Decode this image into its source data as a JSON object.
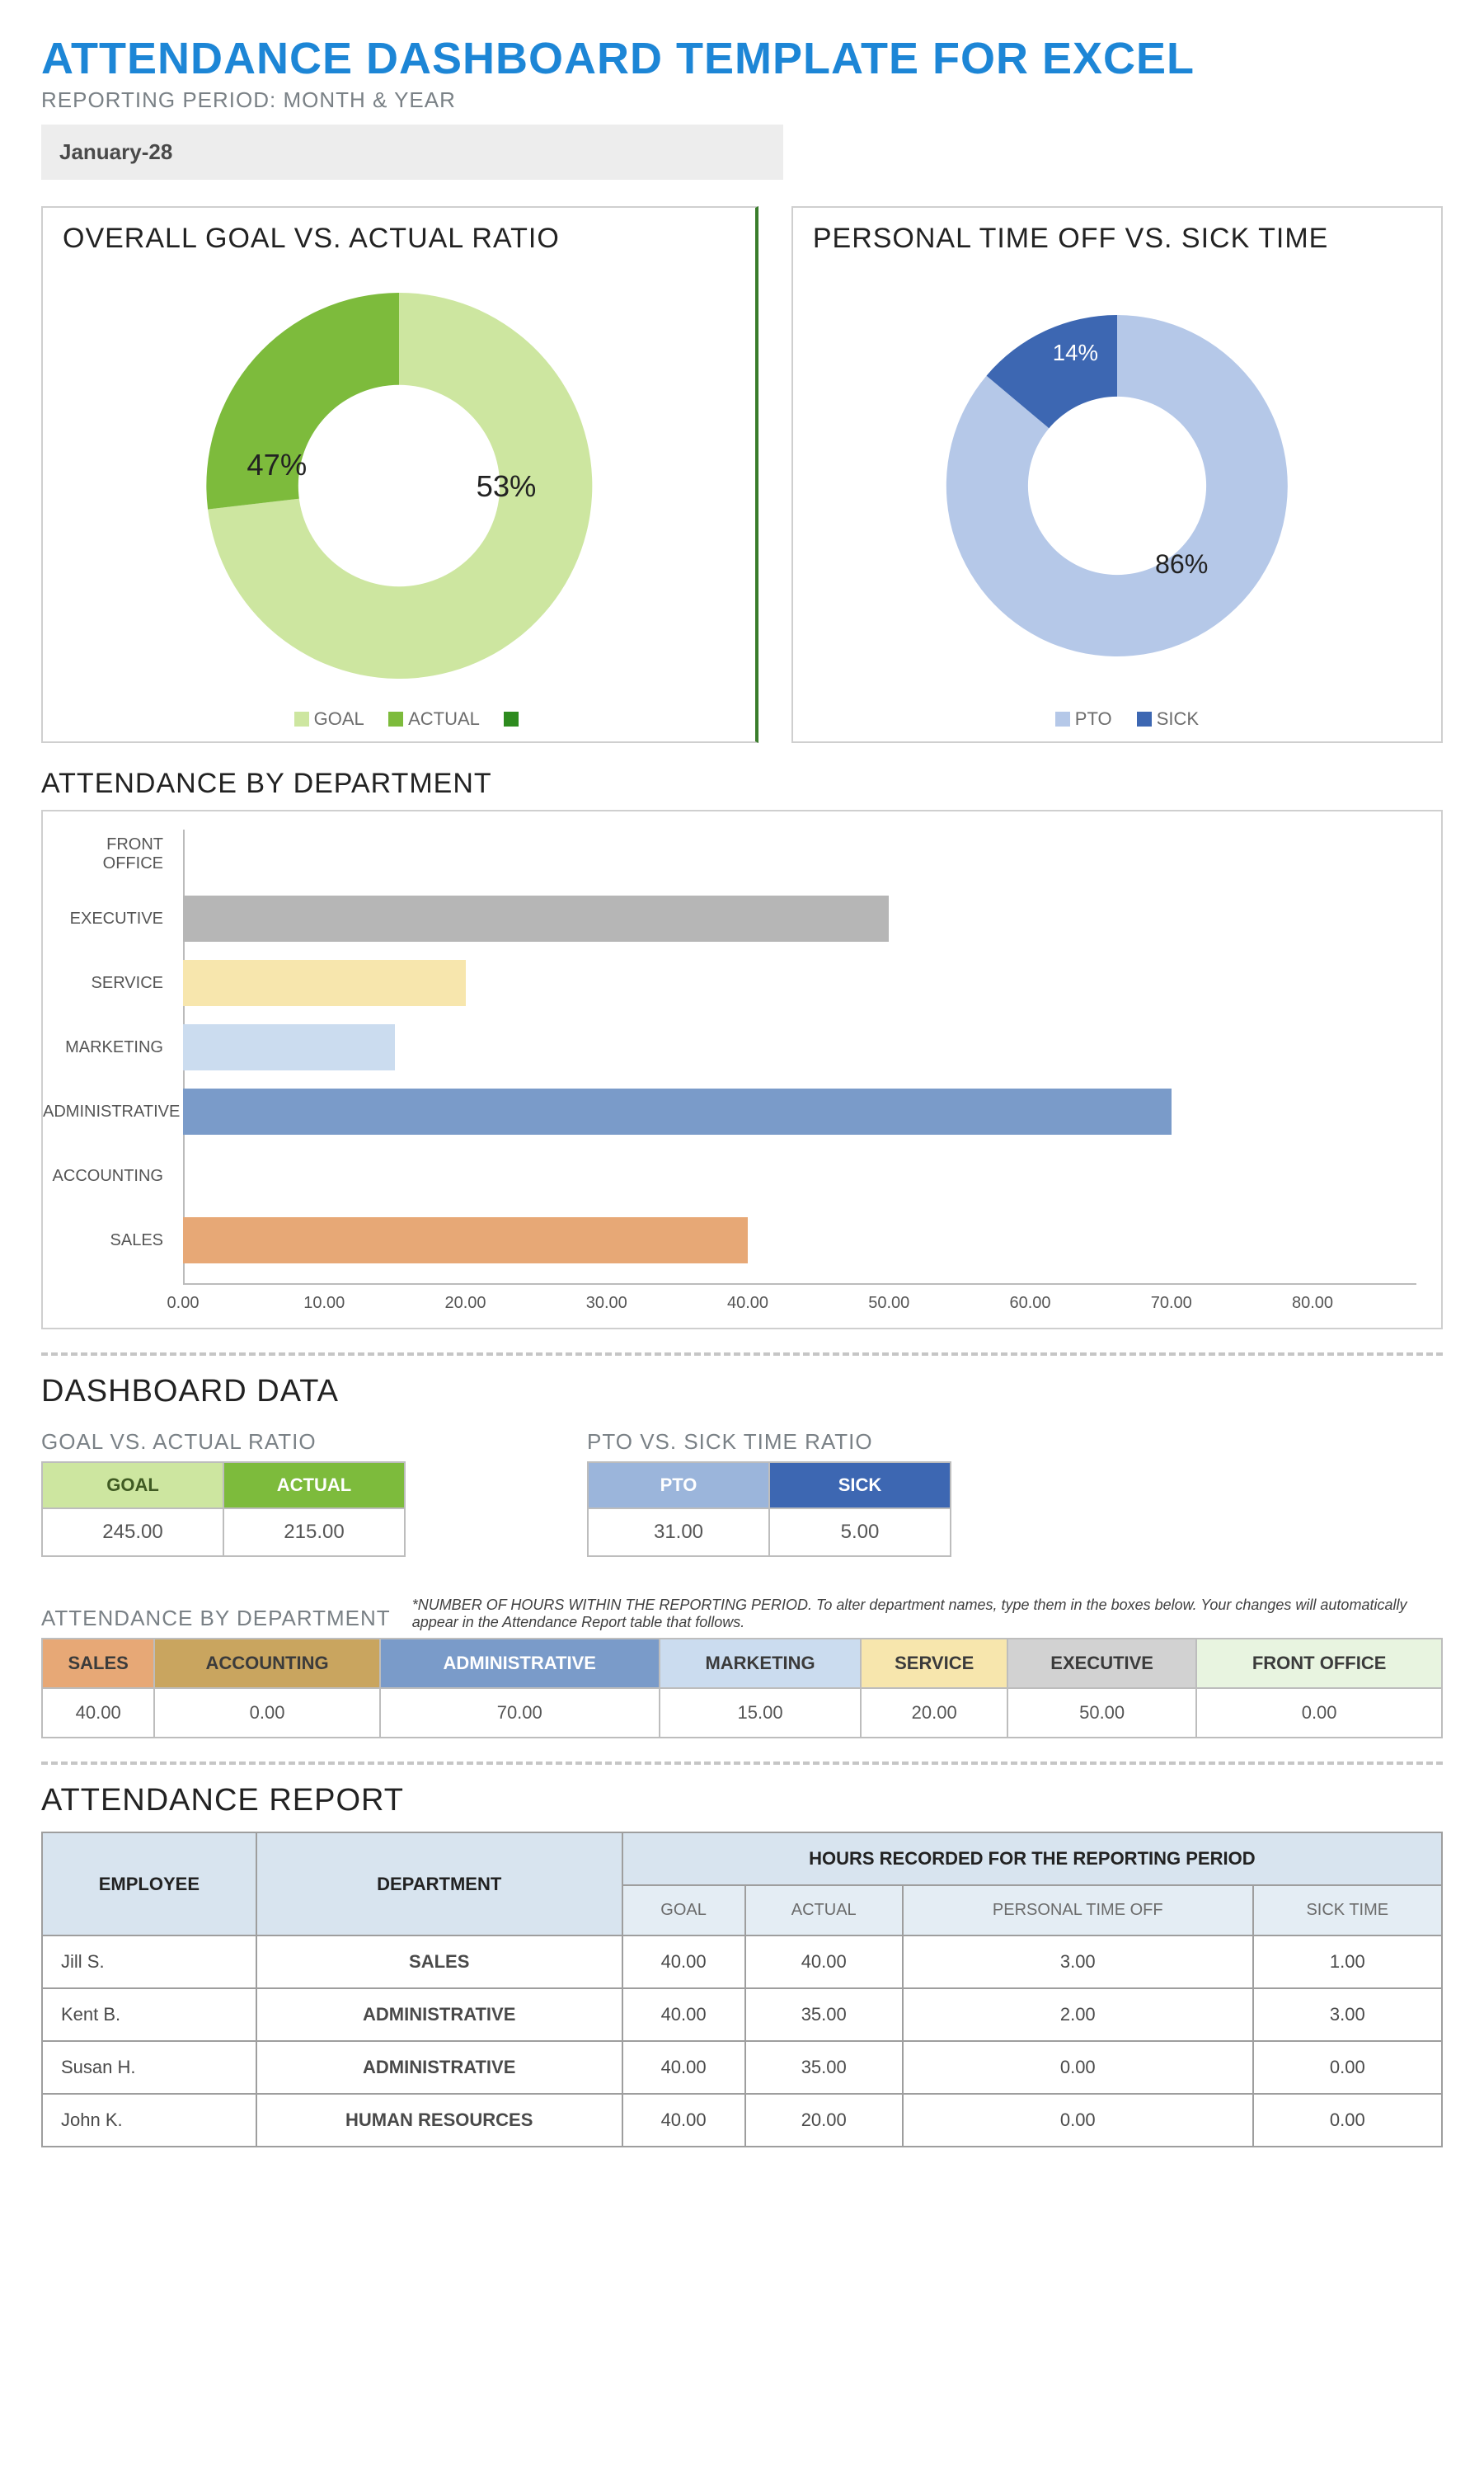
{
  "title": "ATTENDANCE DASHBOARD TEMPLATE FOR EXCEL",
  "subtitle": "REPORTING PERIOD: MONTH & YEAR",
  "period_value": "January-28",
  "panels": {
    "goal_vs_actual": {
      "title": "OVERALL GOAL VS. ACTUAL RATIO",
      "legend": {
        "a": "GOAL",
        "b": "ACTUAL",
        "c": ""
      },
      "label_a": "53%",
      "label_b": "47%"
    },
    "pto_vs_sick": {
      "title": "PERSONAL TIME OFF VS. SICK TIME",
      "legend": {
        "a": "PTO",
        "b": "SICK"
      },
      "label_a": "86%",
      "label_b": "14%"
    }
  },
  "attendance_by_dept_title": "ATTENDANCE BY DEPARTMENT",
  "dashboard_data": {
    "title": "DASHBOARD DATA",
    "goal_vs_actual": {
      "title": "GOAL VS. ACTUAL RATIO",
      "h1": "GOAL",
      "h2": "ACTUAL",
      "v1": "245.00",
      "v2": "215.00"
    },
    "pto_vs_sick": {
      "title": "PTO VS. SICK TIME RATIO",
      "h1": "PTO",
      "h2": "SICK",
      "v1": "31.00",
      "v2": "5.00"
    },
    "by_dept": {
      "title": "ATTENDANCE BY DEPARTMENT",
      "note": "*NUMBER OF HOURS WITHIN THE REPORTING PERIOD. To alter department names, type them in the boxes below. Your changes will automatically appear in the Attendance Report table that follows.",
      "headers": [
        "SALES",
        "ACCOUNTING",
        "ADMINISTRATIVE",
        "MARKETING",
        "SERVICE",
        "EXECUTIVE",
        "FRONT OFFICE"
      ],
      "values": [
        "40.00",
        "0.00",
        "70.00",
        "15.00",
        "20.00",
        "50.00",
        "0.00"
      ]
    }
  },
  "report": {
    "title": "ATTENDANCE REPORT",
    "h_employee": "EMPLOYEE",
    "h_department": "DEPARTMENT",
    "h_hours": "HOURS RECORDED FOR THE REPORTING PERIOD",
    "sub": [
      "GOAL",
      "ACTUAL",
      "PERSONAL TIME OFF",
      "SICK TIME"
    ],
    "rows": [
      {
        "emp": "Jill S.",
        "dept": "SALES",
        "c": [
          "40.00",
          "40.00",
          "3.00",
          "1.00"
        ]
      },
      {
        "emp": "Kent B.",
        "dept": "ADMINISTRATIVE",
        "c": [
          "40.00",
          "35.00",
          "2.00",
          "3.00"
        ]
      },
      {
        "emp": "Susan H.",
        "dept": "ADMINISTRATIVE",
        "c": [
          "40.00",
          "35.00",
          "0.00",
          "0.00"
        ]
      },
      {
        "emp": "John K.",
        "dept": "HUMAN RESOURCES",
        "c": [
          "40.00",
          "20.00",
          "0.00",
          "0.00"
        ]
      }
    ]
  },
  "chart_data": [
    {
      "type": "pie",
      "title": "OVERALL GOAL VS. ACTUAL RATIO",
      "series": [
        {
          "name": "ratio",
          "categories": [
            "GOAL",
            "ACTUAL"
          ],
          "values": [
            53,
            47
          ]
        }
      ],
      "colors": [
        "#cde6a0",
        "#7dbb3c"
      ],
      "donut_hole": true
    },
    {
      "type": "pie",
      "title": "PERSONAL TIME OFF VS. SICK TIME",
      "series": [
        {
          "name": "ratio",
          "categories": [
            "PTO",
            "SICK"
          ],
          "values": [
            86,
            14
          ]
        }
      ],
      "colors": [
        "#b5c8e8",
        "#3d67b2"
      ],
      "donut_hole": true
    },
    {
      "type": "bar",
      "title": "ATTENDANCE BY DEPARTMENT",
      "orientation": "horizontal",
      "categories": [
        "FRONT OFFICE",
        "EXECUTIVE",
        "SERVICE",
        "MARKETING",
        "ADMINISTRATIVE",
        "ACCOUNTING",
        "SALES"
      ],
      "values": [
        0,
        50,
        20,
        15,
        70,
        0,
        40
      ],
      "colors": [
        "#e8f4e0",
        "#b6b6b6",
        "#f7e6ad",
        "#cbdcef",
        "#7a9bc9",
        "#a3b58a",
        "#e7a876"
      ],
      "xlabel": "",
      "ylabel": "",
      "xticks": [
        "0.00",
        "10.00",
        "20.00",
        "30.00",
        "40.00",
        "50.00",
        "60.00",
        "70.00",
        "80.00"
      ],
      "xlim": [
        0,
        80
      ]
    }
  ],
  "colors": {
    "goal_light": "#cde6a0",
    "goal_mid": "#7dbb3c",
    "goal_dark": "#2e8b1f",
    "pto_light": "#b5c8e8",
    "pto_dark": "#3d67b2",
    "dept_header": {
      "SALES": "#e7a876",
      "ACCOUNTING": "#c9a55f",
      "ADMINISTRATIVE": "#7a9bc9",
      "MARKETING": "#cbdcef",
      "SERVICE": "#f7e6ad",
      "EXECUTIVE": "#d2d2d2",
      "FRONT OFFICE": "#e8f4e0"
    }
  }
}
